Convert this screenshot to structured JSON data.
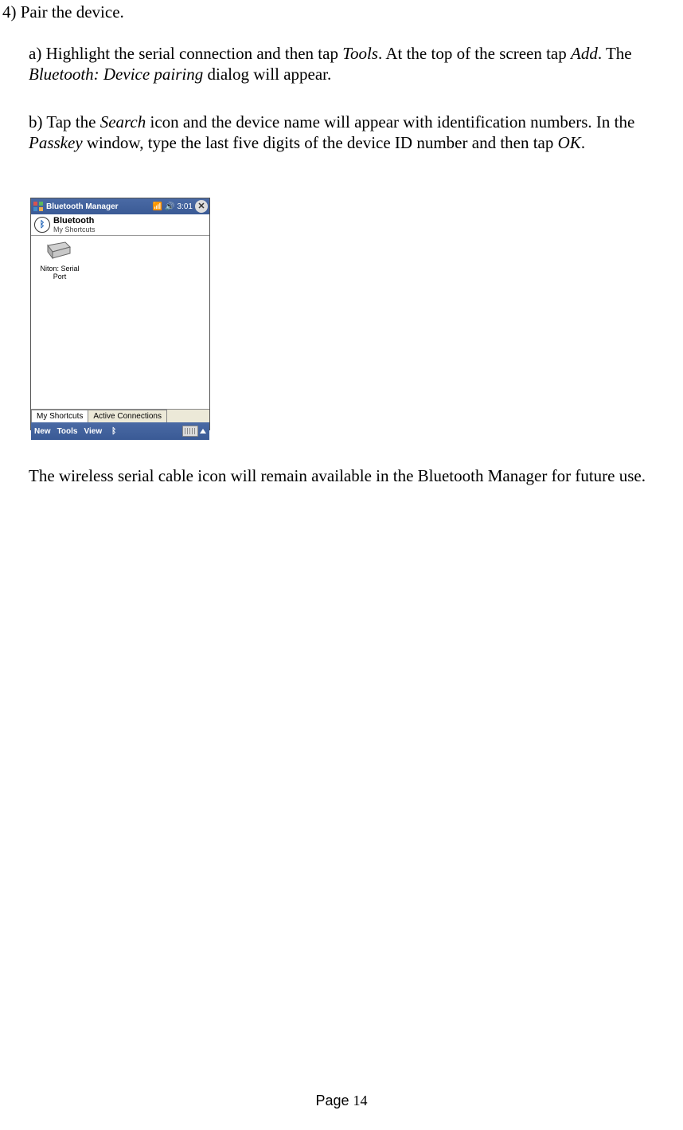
{
  "step4": "4) Pair the device.",
  "sub_a": {
    "pre_tools": "a) Highlight the serial connection and then tap ",
    "tools": "Tools",
    "after_tools": ". At the top of the screen tap ",
    "add": "Add",
    "after_add": ". The ",
    "dialog": "Bluetooth: Device pairing",
    "after_dialog": " dialog will appear."
  },
  "sub_b": {
    "pre_search": "b) Tap the ",
    "search": "Search",
    "after_search": " icon and the device name will appear with identification numbers. In the ",
    "passkey": "Passkey",
    "after_passkey": " window, type the last five digits of the device ID number and then tap ",
    "ok": "OK",
    "period": "."
  },
  "screenshot": {
    "title": "Bluetooth Manager",
    "time": "3:01",
    "header_line1": "Bluetooth",
    "header_line2": "My Shortcuts",
    "device_label": "Niton: Serial Port",
    "tab_shortcuts": "My Shortcuts",
    "tab_active_conn": "Active Connections",
    "menu_new": "New",
    "menu_tools": "Tools",
    "menu_view": "View",
    "close_glyph": "✕",
    "bt_glyph": "ᛒ",
    "signal_glyph": "📶",
    "sound_glyph": "🔊"
  },
  "concluding": "The wireless serial cable icon will remain available in the Bluetooth Manager for future use.",
  "page_label": "Page ",
  "page_number": "14"
}
